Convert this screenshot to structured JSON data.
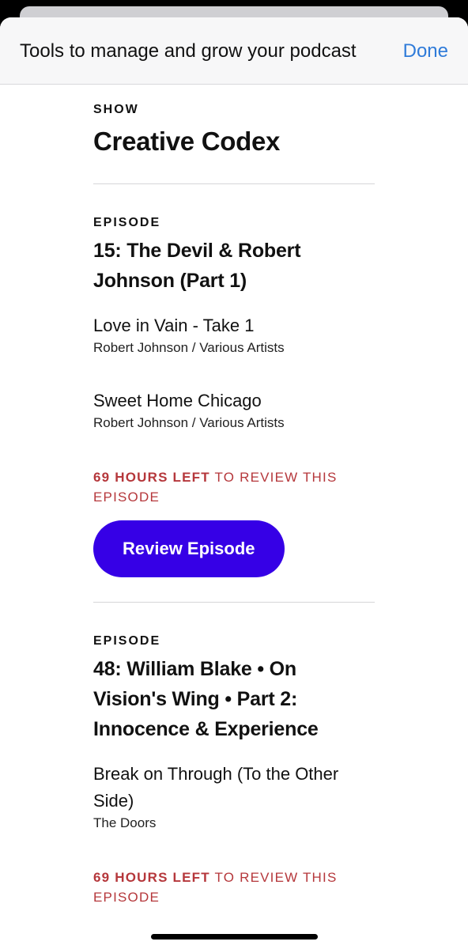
{
  "header": {
    "title": "Tools to manage and grow your podcast",
    "done_label": "Done"
  },
  "show": {
    "label": "SHOW",
    "title": "Creative Codex"
  },
  "episodes": [
    {
      "label": "EPISODE",
      "title": "15: The Devil & Robert Johnson (Part 1)",
      "tracks": [
        {
          "name": "Love in Vain - Take 1",
          "artist": "Robert Johnson / Various Artists"
        },
        {
          "name": "Sweet Home Chicago",
          "artist": "Robert Johnson / Various Artists"
        }
      ],
      "countdown_strong": "69 HOURS LEFT",
      "countdown_rest": "TO REVIEW THIS EPISODE",
      "button_label": "Review Episode"
    },
    {
      "label": "EPISODE",
      "title": "48: William Blake • On Vision's Wing • Part 2: Innocence & Experience",
      "tracks": [
        {
          "name": "Break on Through (To the Other Side)",
          "artist": "The Doors"
        }
      ],
      "countdown_strong": "69 HOURS LEFT",
      "countdown_rest": "TO REVIEW THIS EPISODE"
    }
  ],
  "colors": {
    "accent": "#3600E6",
    "link": "#2F7BD9",
    "warning": "#B5373B"
  }
}
